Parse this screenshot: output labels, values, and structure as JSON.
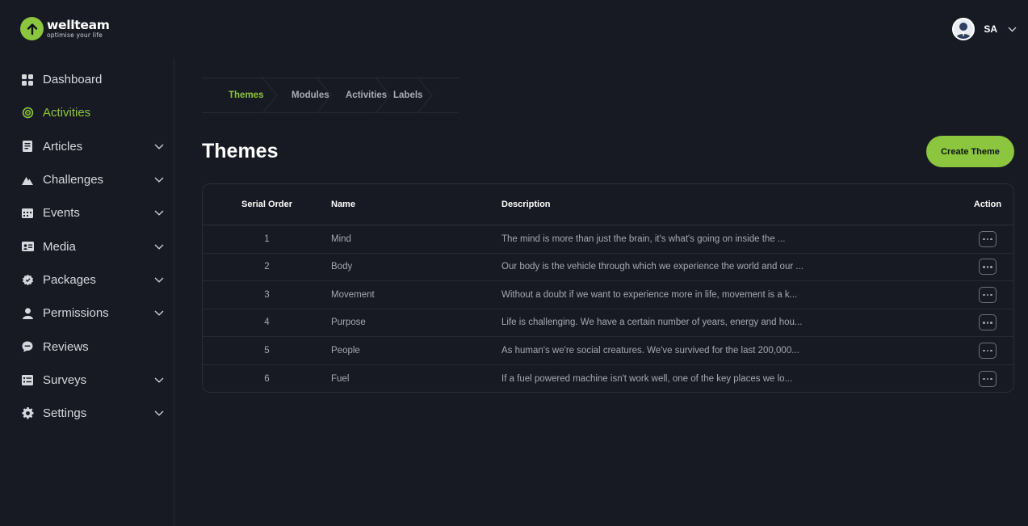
{
  "brand": {
    "name": "wellteam",
    "tagline": "optimise your life",
    "accent": "#8cc63f"
  },
  "user": {
    "initials": "SA"
  },
  "sidebar": {
    "items": [
      {
        "label": "Dashboard",
        "icon": "grid-icon",
        "expandable": false,
        "active": false
      },
      {
        "label": "Activities",
        "icon": "target-icon",
        "expandable": false,
        "active": true
      },
      {
        "label": "Articles",
        "icon": "article-icon",
        "expandable": true,
        "active": false
      },
      {
        "label": "Challenges",
        "icon": "mountain-icon",
        "expandable": true,
        "active": false
      },
      {
        "label": "Events",
        "icon": "calendar-icon",
        "expandable": true,
        "active": false
      },
      {
        "label": "Media",
        "icon": "media-icon",
        "expandable": true,
        "active": false
      },
      {
        "label": "Packages",
        "icon": "package-icon",
        "expandable": true,
        "active": false
      },
      {
        "label": "Permissions",
        "icon": "user-icon",
        "expandable": true,
        "active": false
      },
      {
        "label": "Reviews",
        "icon": "chat-icon",
        "expandable": false,
        "active": false
      },
      {
        "label": "Surveys",
        "icon": "survey-icon",
        "expandable": true,
        "active": false
      },
      {
        "label": "Settings",
        "icon": "gear-icon",
        "expandable": true,
        "active": false
      }
    ]
  },
  "tabs": [
    {
      "label": "Themes",
      "active": true
    },
    {
      "label": "Modules",
      "active": false
    },
    {
      "label": "Activities",
      "active": false
    },
    {
      "label": "Labels",
      "active": false
    }
  ],
  "page": {
    "title": "Themes",
    "create_label": "Create Theme"
  },
  "table": {
    "headers": {
      "order": "Serial Order",
      "name": "Name",
      "description": "Description",
      "action": "Action"
    },
    "rows": [
      {
        "order": "1",
        "name": "Mind",
        "description": "The mind is more than just the brain, it's what's going on inside the ..."
      },
      {
        "order": "2",
        "name": "Body",
        "description": "Our body is the vehicle through which we experience the world and our ..."
      },
      {
        "order": "3",
        "name": "Movement",
        "description": "Without a doubt if we want to experience more in life, movement is a k..."
      },
      {
        "order": "4",
        "name": "Purpose",
        "description": "Life is challenging. We have a certain number of years, energy and hou..."
      },
      {
        "order": "5",
        "name": "People",
        "description": "As human's we're social creatures. We've survived for the last 200,000..."
      },
      {
        "order": "6",
        "name": "Fuel",
        "description": "If a fuel powered machine isn't work well, one of the key places we lo..."
      }
    ]
  }
}
